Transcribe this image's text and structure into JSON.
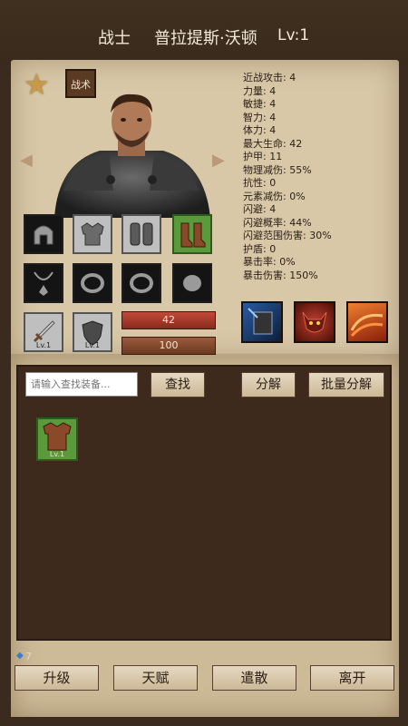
{
  "header": {
    "class_label": "战士",
    "character_name": "普拉提斯·沃顿",
    "level": "Lv:1"
  },
  "tactics_label": "战术",
  "stats": [
    "近战攻击: 4",
    "力量: 4",
    "敏捷: 4",
    "智力: 4",
    "体力: 4",
    "最大生命: 42",
    "护甲: 11",
    "物理减伤: 55%",
    "抗性: 0",
    "元素减伤: 0%",
    "闪避: 4",
    "闪避概率: 44%",
    "闪避范围伤害: 30%",
    "护盾: 0",
    "暴击率: 0%",
    "暴击伤害: 150%"
  ],
  "equipment": {
    "weapon_level": "Lv.1",
    "offhand_level": "Lv.1"
  },
  "bars": {
    "health": "42",
    "secondary": "100"
  },
  "inventory": {
    "search_placeholder": "请输入查找装备...",
    "search_button": "查找",
    "decompose_button": "分解",
    "batch_decompose_button": "批量分解",
    "item_level": "Lv.1"
  },
  "gem_count": "7",
  "bottom_nav": {
    "upgrade": "升级",
    "talent": "天赋",
    "dismiss": "遣散",
    "leave": "离开"
  },
  "colors": {
    "background": "#3b2a1e",
    "parchment": "#d8c8a8",
    "panel": "#3e2a1c",
    "rare_green": "#5a9a3a",
    "health_red": "#b03a2e"
  }
}
